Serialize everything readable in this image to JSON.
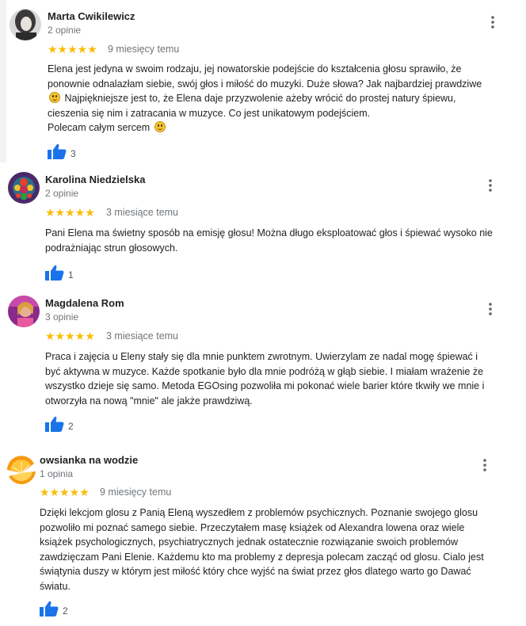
{
  "reviews": [
    {
      "name": "Marta Cwikilewicz",
      "count": "2 opinie",
      "stars": "★★★★★",
      "age": "9 miesięcy temu",
      "text_lines": [
        "Elena jest jedyna w swoim rodzaju, jej nowatorskie podejście do kształcenia głosu sprawiło, że",
        "ponownie odnalazłam siebie, swój głos i miłość do muzyki. Duże słowa? Jak najbardziej prawdziwe",
        " Najpiękniejsze jest to, że Elena daje przyzwolenie ażeby wrócić do prostej natury śpiewu,",
        "cieszenia się nim i zatracania w muzyce. Co jest unikatowym podejściem.",
        "Polecam całym sercem "
      ],
      "likes": "3"
    },
    {
      "name": "Karolina Niedzielska",
      "count": "2 opinie",
      "stars": "★★★★★",
      "age": "3 miesiące temu",
      "text_lines": [
        "Pani Elena ma świetny sposób na emisję głosu! Można długo eksploatować głos i śpiewać wysoko nie",
        "podrażniając strun głosowych."
      ],
      "likes": "1"
    },
    {
      "name": "Magdalena Rom",
      "count": "3 opinie",
      "stars": "★★★★★",
      "age": "3 miesiące temu",
      "text_lines": [
        "Praca i zajęcia u Eleny stały się dla mnie punktem zwrotnym. Uwierzylam ze nadal mogę śpiewać i",
        "być aktywna w muzyce. Każde spotkanie było dla mnie podróżą w głąb siebie. I miałam wrażenie że",
        "wszystko dzieje się samo. Metoda EGOsing pozwoliła mi pokonać wiele barier które tkwiły we mnie i",
        "otworzyła na nową \"mnie\" ale jakże prawdziwą."
      ],
      "likes": "2"
    },
    {
      "name": "owsianka na wodzie",
      "count": "1 opinia",
      "stars": "★★★★★",
      "age": "9 miesięcy temu",
      "text_lines": [
        "Dzięki lekcjom glosu z Panią Eleną wyszedłem z problemów psychicznych. Poznanie swojego glosu",
        "pozwoliło mi poznać samego siebie. Przeczytałem masę książek od Alexandra lowena oraz wiele",
        "książek psychologicznych, psychiatrycznych jednak ostatecznie rozwiązanie swoich problemów",
        "zawdzięczam Pani Elenie. Każdemu kto ma problemy z depresja polecam zacząć od glosu. Cialo jest",
        "świątynia duszy w którym jest miłość który chce wyjść na świat przez głos dlatego warto go Dawać",
        "światu."
      ],
      "likes": "2"
    }
  ],
  "icons": {
    "menu": "more-vert-icon",
    "like": "thumb-up-icon",
    "star_color": "#fbbc04",
    "like_color": "#1a73e8"
  }
}
